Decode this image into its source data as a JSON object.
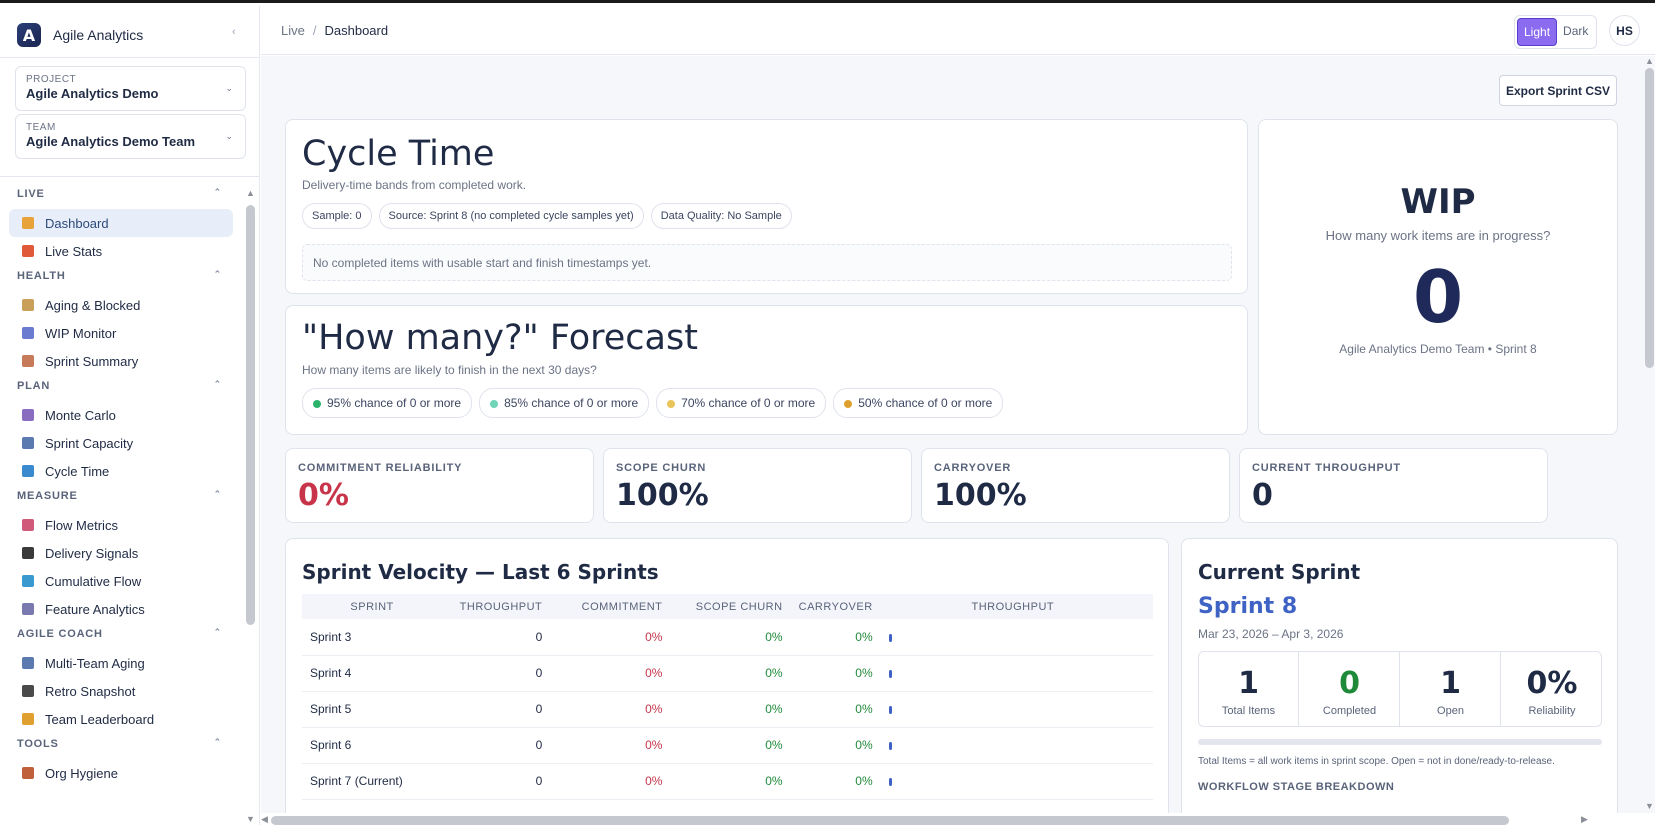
{
  "brand": {
    "name": "Agile Analytics",
    "logo_letter": "A",
    "collapse": "‹"
  },
  "selectors": {
    "project": {
      "label": "PROJECT",
      "value": "Agile Analytics Demo"
    },
    "team": {
      "label": "TEAM",
      "value": "Agile Analytics Demo Team"
    }
  },
  "nav": {
    "sections": [
      {
        "title": "LIVE",
        "items": [
          {
            "label": "Dashboard",
            "icon": "bar-chart-icon",
            "color": "#e8a23a"
          },
          {
            "label": "Live Stats",
            "icon": "lightning-icon",
            "color": "#e05a3a"
          }
        ]
      },
      {
        "title": "HEALTH",
        "items": [
          {
            "label": "Aging & Blocked",
            "icon": "hourglass-icon",
            "color": "#c9a05a"
          },
          {
            "label": "WIP Monitor",
            "icon": "line-chart-icon",
            "color": "#6b7bd0"
          },
          {
            "label": "Sprint Summary",
            "icon": "clipboard-icon",
            "color": "#c77a5a"
          }
        ]
      },
      {
        "title": "PLAN",
        "items": [
          {
            "label": "Monte Carlo",
            "icon": "dice-icon",
            "color": "#8a6cc0"
          },
          {
            "label": "Sprint Capacity",
            "icon": "calendar-icon",
            "color": "#5a7ab0"
          },
          {
            "label": "Cycle Time",
            "icon": "cycle-icon",
            "color": "#3a8ad0"
          }
        ]
      },
      {
        "title": "MEASURE",
        "items": [
          {
            "label": "Flow Metrics",
            "icon": "trend-down-icon",
            "color": "#d05a7a"
          },
          {
            "label": "Delivery Signals",
            "icon": "traffic-light-icon",
            "color": "#3a3a3a"
          },
          {
            "label": "Cumulative Flow",
            "icon": "wave-icon",
            "color": "#3a9ad0"
          },
          {
            "label": "Feature Analytics",
            "icon": "microscope-icon",
            "color": "#7a7ab0"
          }
        ]
      },
      {
        "title": "AGILE COACH",
        "items": [
          {
            "label": "Multi-Team Aging",
            "icon": "calendar-icon",
            "color": "#5a7ab0"
          },
          {
            "label": "Retro Snapshot",
            "icon": "camera-icon",
            "color": "#4a4a4a"
          },
          {
            "label": "Team Leaderboard",
            "icon": "trophy-icon",
            "color": "#e0a030"
          }
        ]
      },
      {
        "title": "TOOLS",
        "items": [
          {
            "label": "Org Hygiene",
            "icon": "broom-icon",
            "color": "#c0603a"
          }
        ]
      }
    ]
  },
  "breadcrumb": {
    "parent": "Live",
    "sep": "/",
    "current": "Dashboard"
  },
  "theme": {
    "light": "Light",
    "dark": "Dark"
  },
  "user": {
    "initials": "HS"
  },
  "export_label": "Export Sprint CSV",
  "cycle_time": {
    "title": "Cycle Time",
    "subtitle": "Delivery-time bands from completed work.",
    "pills": [
      "Sample: 0",
      "Source: Sprint 8 (no completed cycle samples yet)",
      "Data Quality: No Sample"
    ],
    "empty": "No completed items with usable start and finish timestamps yet."
  },
  "forecast": {
    "title": "\"How many?\" Forecast",
    "subtitle": "How many items are likely to finish in the next 30 days?",
    "pills": [
      {
        "label": "95% chance of 0 or more",
        "color": "#2bb36a"
      },
      {
        "label": "85% chance of 0 or more",
        "color": "#6fd4b8"
      },
      {
        "label": "70% chance of 0 or more",
        "color": "#e8c45a"
      },
      {
        "label": "50% chance of 0 or more",
        "color": "#e0a030"
      }
    ]
  },
  "wip": {
    "title": "WIP",
    "question": "How many work items are in progress?",
    "value": "0",
    "caption": "Agile Analytics Demo Team • Sprint 8"
  },
  "kpis": [
    {
      "label": "COMMITMENT RELIABILITY",
      "value": "0%",
      "color": "#c8354a"
    },
    {
      "label": "SCOPE CHURN",
      "value": "100%",
      "color": "#1f2a44"
    },
    {
      "label": "CARRYOVER",
      "value": "100%",
      "color": "#1f2a44"
    },
    {
      "label": "CURRENT THROUGHPUT",
      "value": "0",
      "color": "#1f2a44"
    }
  ],
  "velocity": {
    "title": "Sprint Velocity — Last 6 Sprints",
    "headers": [
      "SPRINT",
      "THROUGHPUT",
      "COMMITMENT",
      "SCOPE CHURN",
      "CARRYOVER",
      "THROUGHPUT"
    ],
    "rows": [
      {
        "sprint": "Sprint 3",
        "throughput": "0",
        "commitment": "0%",
        "churn": "0%",
        "carryover": "0%",
        "bar": 0
      },
      {
        "sprint": "Sprint 4",
        "throughput": "0",
        "commitment": "0%",
        "churn": "0%",
        "carryover": "0%",
        "bar": 0
      },
      {
        "sprint": "Sprint 5",
        "throughput": "0",
        "commitment": "0%",
        "churn": "0%",
        "carryover": "0%",
        "bar": 0
      },
      {
        "sprint": "Sprint 6",
        "throughput": "0",
        "commitment": "0%",
        "churn": "0%",
        "carryover": "0%",
        "bar": 0
      },
      {
        "sprint": "Sprint 7 (Current)",
        "throughput": "0",
        "commitment": "0%",
        "churn": "0%",
        "carryover": "0%",
        "bar": 0
      }
    ]
  },
  "current_sprint": {
    "title": "Current Sprint",
    "name": "Sprint 8",
    "dates": "Mar 23, 2026 – Apr 3, 2026",
    "stats": [
      {
        "value": "1",
        "label": "Total Items",
        "color": "#1f2a44"
      },
      {
        "value": "0",
        "label": "Completed",
        "color": "#1f8a3a"
      },
      {
        "value": "1",
        "label": "Open",
        "color": "#1f2a44"
      },
      {
        "value": "0%",
        "label": "Reliability",
        "color": "#1f2a44"
      }
    ],
    "progress": 0,
    "note": "Total Items = all work items in sprint scope. Open = not in done/ready-to-release.",
    "breakdown_title": "WORKFLOW STAGE BREAKDOWN"
  }
}
